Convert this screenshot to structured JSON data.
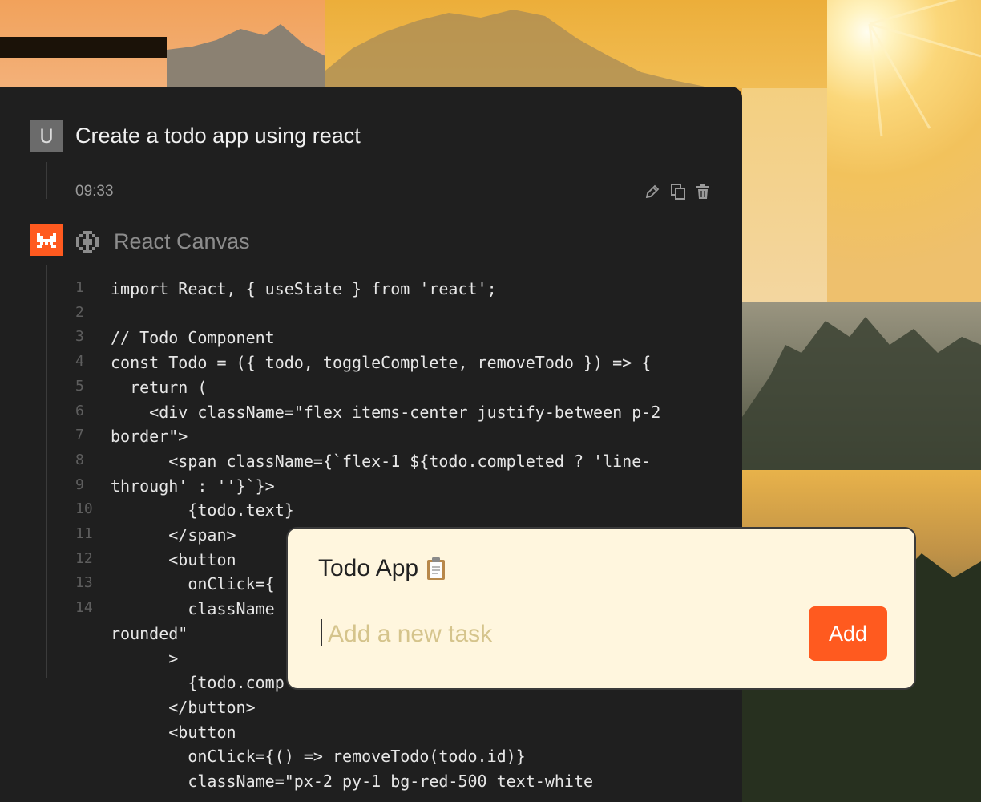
{
  "chat": {
    "user_avatar_letter": "U",
    "user_message": "Create a todo app using react",
    "timestamp": "09:33",
    "assistant_tool_label": "React Canvas"
  },
  "code": [
    {
      "n": "1",
      "t": "import React, { useState } from 'react';"
    },
    {
      "n": "2",
      "t": ""
    },
    {
      "n": "3",
      "t": "// Todo Component"
    },
    {
      "n": "4",
      "t": "const Todo = ({ todo, toggleComplete, removeTodo }) => {"
    },
    {
      "n": "5",
      "t": "  return ("
    },
    {
      "n": "6",
      "t": "    <div className=\"flex items-center justify-between p-2"
    },
    {
      "n": "7",
      "t": "border\">"
    },
    {
      "n": "8",
      "t": "      <span className={`flex-1 ${todo.completed ? 'line-"
    },
    {
      "n": "9",
      "t": "through' : ''}`}>"
    },
    {
      "n": "10",
      "t": "        {todo.text}"
    },
    {
      "n": "11",
      "t": "      </span>"
    },
    {
      "n": "12",
      "t": "      <button"
    },
    {
      "n": "13",
      "t": "        onClick={"
    },
    {
      "n": "14",
      "t": "        className"
    },
    {
      "n": "",
      "t": "rounded\""
    },
    {
      "n": "",
      "t": "      >"
    },
    {
      "n": "",
      "t": "        {todo.comp"
    },
    {
      "n": "",
      "t": "      </button>"
    },
    {
      "n": "",
      "t": "      <button"
    },
    {
      "n": "",
      "t": "        onClick={() => removeTodo(todo.id)}"
    },
    {
      "n": "",
      "t": "        className=\"px-2 py-1 bg-red-500 text-white"
    }
  ],
  "todo_app": {
    "title": "Todo App",
    "title_emoji_icon": "clipboard-icon",
    "input_placeholder": "Add a new task",
    "input_value": "",
    "add_label": "Add"
  },
  "colors": {
    "panel_bg": "#1f1f1f",
    "accent": "#ff5a1f",
    "card_bg": "#fff6de"
  }
}
